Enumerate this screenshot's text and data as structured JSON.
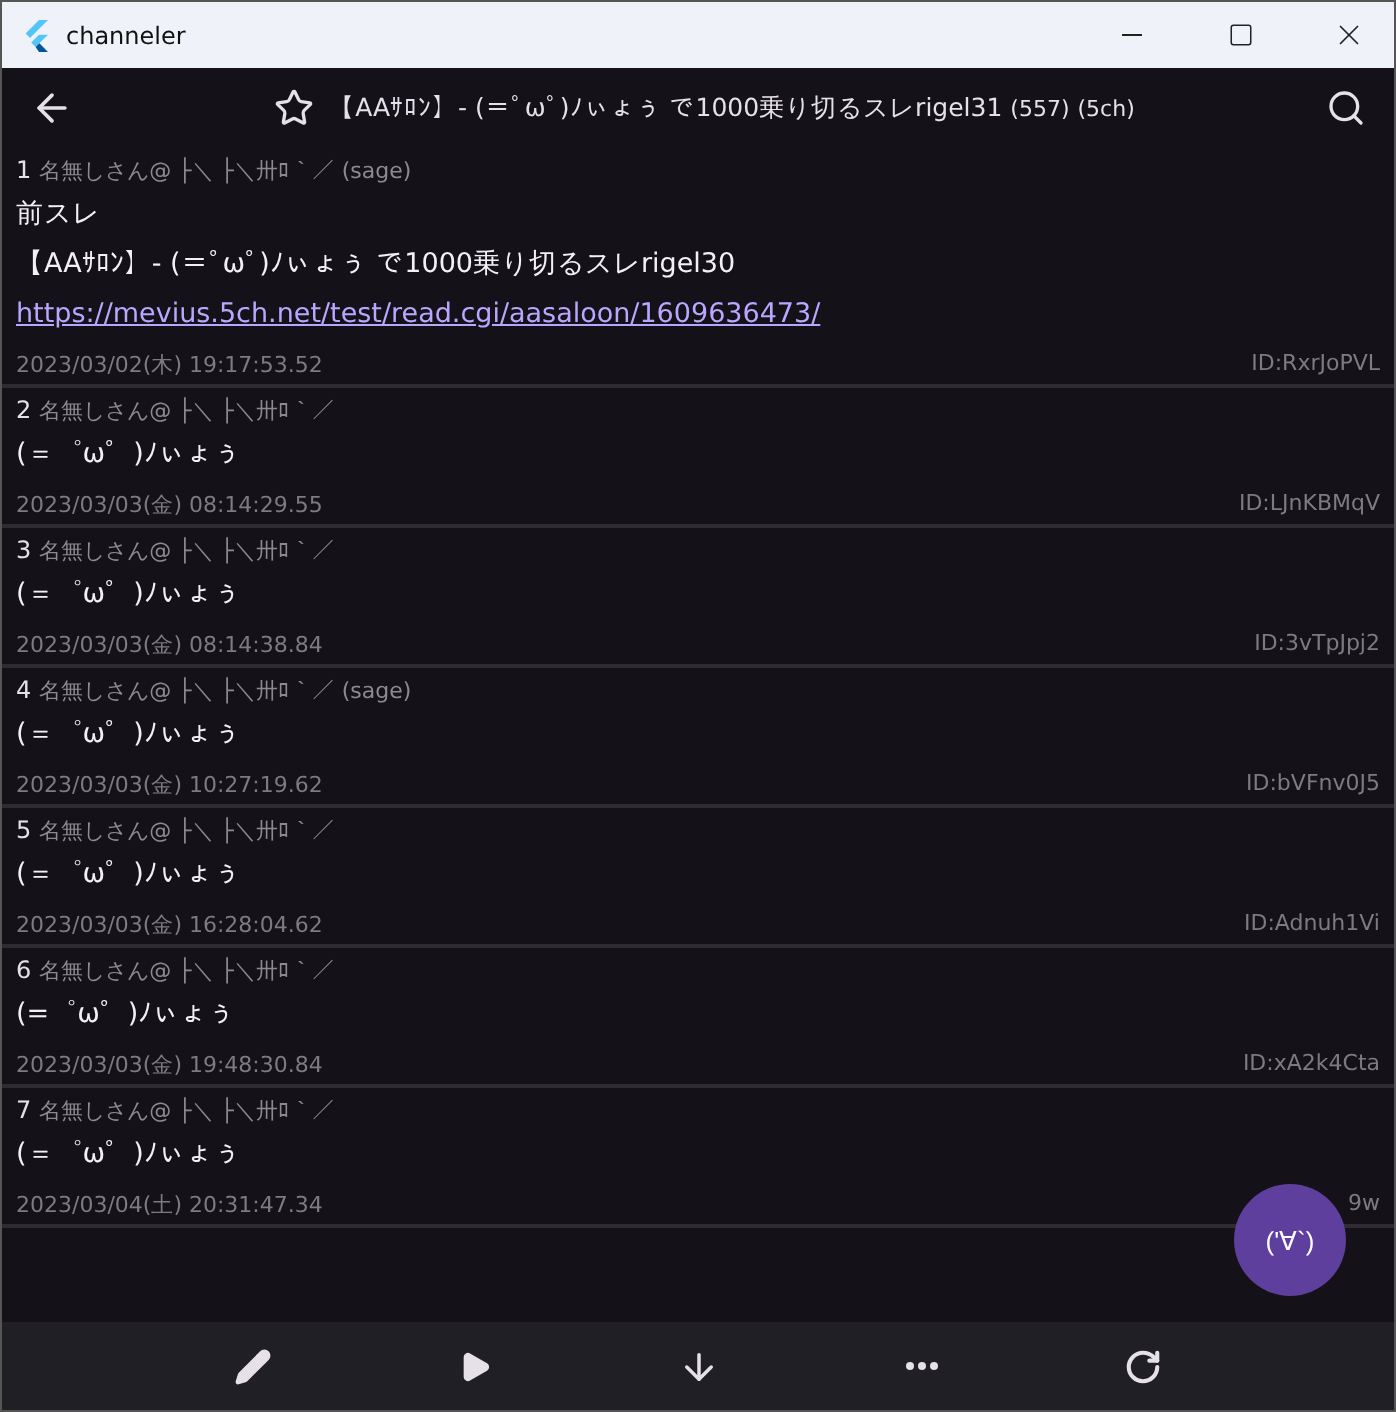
{
  "window": {
    "title": "channeler"
  },
  "app_bar": {
    "title": "【AAｻﾛﾝ】- (＝ﾟωﾟ)ﾉぃょぅ で1000乗り切るスレrigel31",
    "count": "(557)",
    "board": "(5ch)",
    "favorite": false
  },
  "posts": [
    {
      "number": "1",
      "name": "名無しさん@ ├＼ ├＼卅ﾛ｀／",
      "mail": "(sage)",
      "body": [
        {
          "kind": "text",
          "text": "前スレ"
        },
        {
          "kind": "text",
          "text": "【AAｻﾛﾝ】- (＝ﾟωﾟ)ﾉぃょぅ で1000乗り切るスレrigel30"
        },
        {
          "kind": "link",
          "text": "https://mevius.5ch.net/test/read.cgi/aasaloon/1609636473/"
        }
      ],
      "date": "2023/03/02(木) 19:17:53.52",
      "id": "ID:RxrJoPVL"
    },
    {
      "number": "2",
      "name": "名無しさん@ ├＼ ├＼卅ﾛ｀／",
      "body": [
        {
          "kind": "text",
          "text": "(＝゜ω゜)ﾉぃょぅ"
        }
      ],
      "date": "2023/03/03(金) 08:14:29.55",
      "id": "ID:LJnKBMqV"
    },
    {
      "number": "3",
      "name": "名無しさん@ ├＼ ├＼卅ﾛ｀／",
      "body": [
        {
          "kind": "text",
          "text": "(＝゜ω゜)ﾉぃょぅ"
        }
      ],
      "date": "2023/03/03(金) 08:14:38.84",
      "id": "ID:3vTpJpj2"
    },
    {
      "number": "4",
      "name": "名無しさん@ ├＼ ├＼卅ﾛ｀／",
      "mail": "(sage)",
      "body": [
        {
          "kind": "text",
          "text": "(＝゜ω゜)ﾉぃょぅ"
        }
      ],
      "date": "2023/03/03(金) 10:27:19.62",
      "id": "ID:bVFnv0J5"
    },
    {
      "number": "5",
      "name": "名無しさん@ ├＼ ├＼卅ﾛ｀／",
      "body": [
        {
          "kind": "text",
          "text": "(＝゜ω゜)ﾉぃょぅ"
        }
      ],
      "date": "2023/03/03(金) 16:28:04.62",
      "id": "ID:Adnuh1Vi"
    },
    {
      "number": "6",
      "name": "名無しさん@ ├＼ ├＼卅ﾛ｀／",
      "body": [
        {
          "kind": "text",
          "text": "(=゜ω゜)ﾉぃょぅ"
        }
      ],
      "date": "2023/03/03(金) 19:48:30.84",
      "id": "ID:xA2k4Cta"
    },
    {
      "number": "7",
      "name": "名無しさん@ ├＼ ├＼卅ﾛ｀／",
      "body": [
        {
          "kind": "text",
          "text": "(＝゜ω゜)ﾉぃょぅ"
        }
      ],
      "date": "2023/03/04(土) 20:31:47.34",
      "id": "9w"
    }
  ],
  "fab": {
    "label": "('∀`)"
  }
}
